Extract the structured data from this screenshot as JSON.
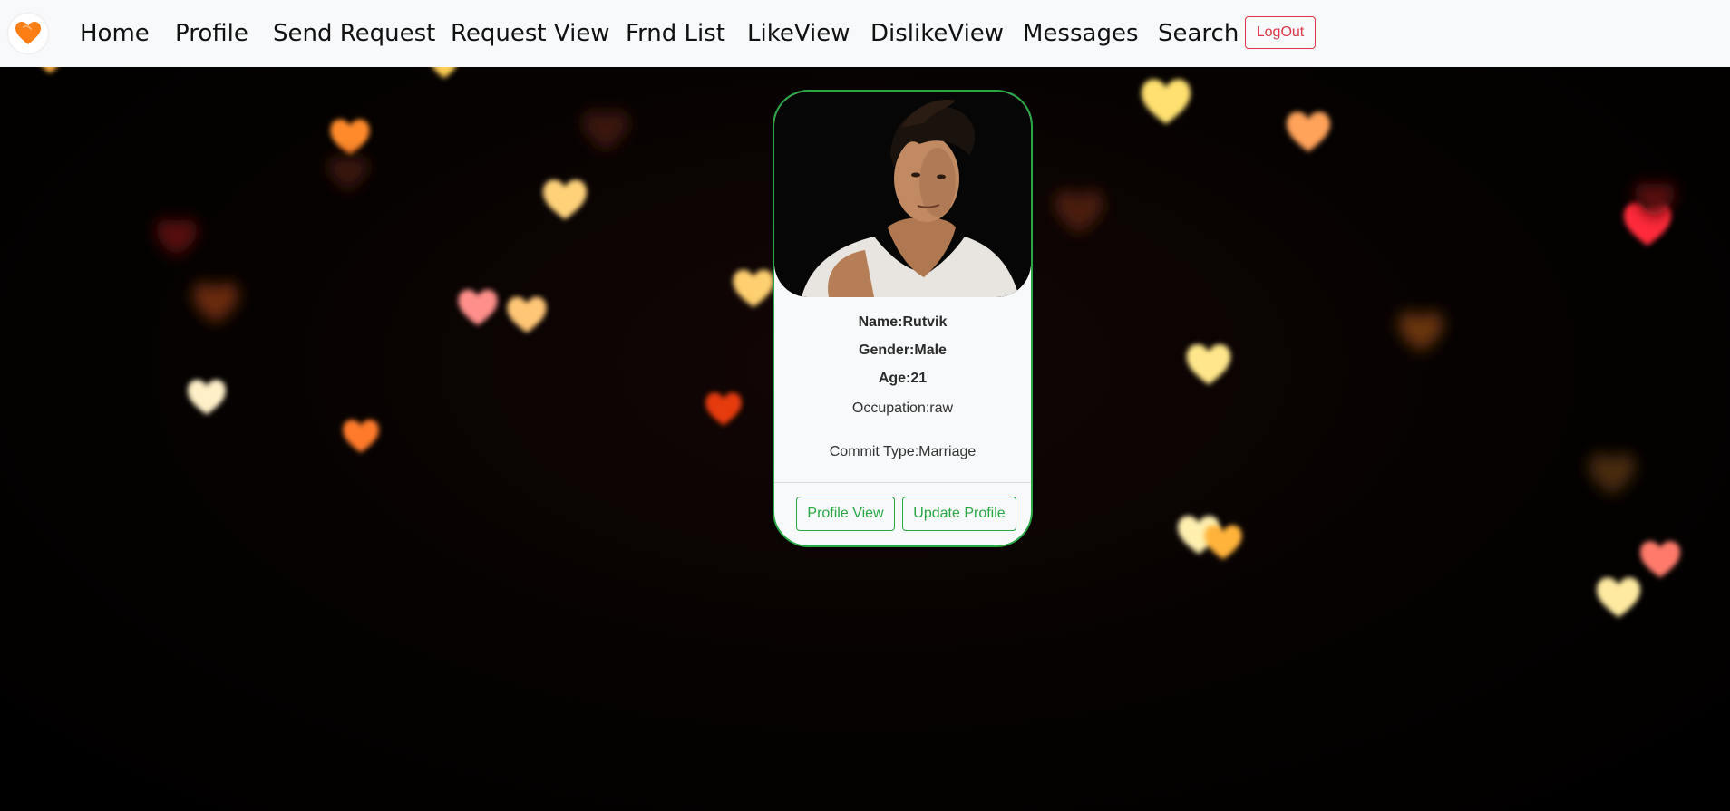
{
  "nav": {
    "items": [
      {
        "label": "Home"
      },
      {
        "label": "Profile"
      },
      {
        "label": "Send Request"
      },
      {
        "label": "Request View"
      },
      {
        "label": "Frnd List"
      },
      {
        "label": "LikeView"
      },
      {
        "label": "DislikeView"
      },
      {
        "label": "Messages"
      },
      {
        "label": "Search"
      }
    ],
    "logout_label": "LogOut"
  },
  "profile_card": {
    "name": "Name:Rutvik",
    "gender": "Gender:Male",
    "age": "Age:21",
    "occupation": "Occupation:raw",
    "commit_type": "Commit Type:Marriage",
    "profile_view_label": "Profile View",
    "update_profile_label": "Update Profile"
  },
  "colors": {
    "navbar_bg": "#f8f9fa",
    "card_border": "#28a745",
    "logout": "#dc3545",
    "brand_heart": "#fd7e14"
  },
  "icons": {
    "brand": "heart-logo-icon"
  }
}
